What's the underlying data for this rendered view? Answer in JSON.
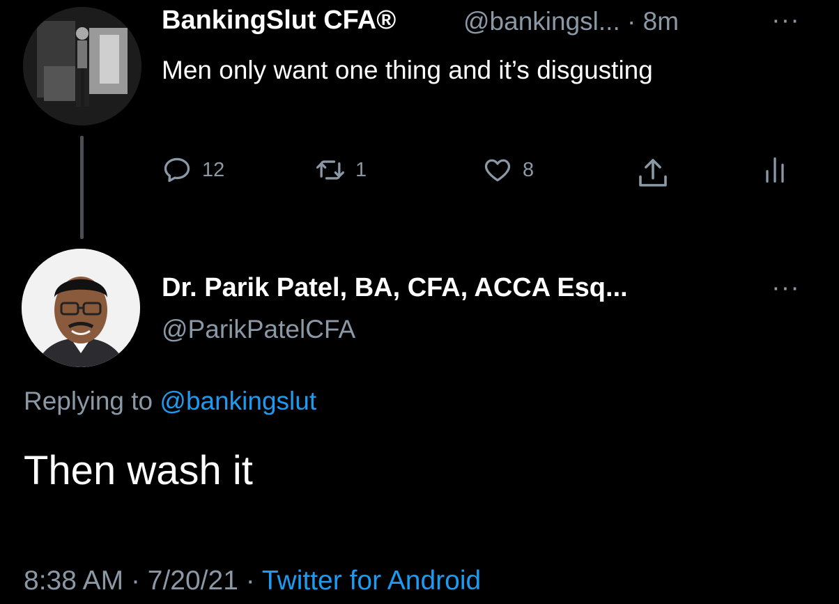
{
  "original_tweet": {
    "display_name": "BankingSlut CFA®",
    "handle": "@bankingsl...",
    "separator": "·",
    "time_ago": "8m",
    "more": "···",
    "text": "Men only want one thing and it’s disgusting",
    "actions": {
      "reply_count": "12",
      "retweet_count": "1",
      "like_count": "8"
    },
    "icons": [
      "reply-icon",
      "retweet-icon",
      "heart-icon",
      "share-icon",
      "analytics-icon"
    ]
  },
  "reply_tweet": {
    "display_name": "Dr. Parik Patel, BA, CFA, ACCA Esq...",
    "handle": "@ParikPatelCFA",
    "more": "···",
    "replying_prefix": "Replying to",
    "replying_to": "@bankingslut",
    "text": "Then wash it",
    "time": "8:38 AM",
    "sep1": "·",
    "date": "7/20/21",
    "sep2": "·",
    "source": "Twitter for Android"
  },
  "colors": {
    "background": "#000000",
    "primary_text": "#ffffff",
    "secondary_text": "#8b98a5",
    "link": "#1d9bf0",
    "thread_line": "#4a4f54"
  }
}
